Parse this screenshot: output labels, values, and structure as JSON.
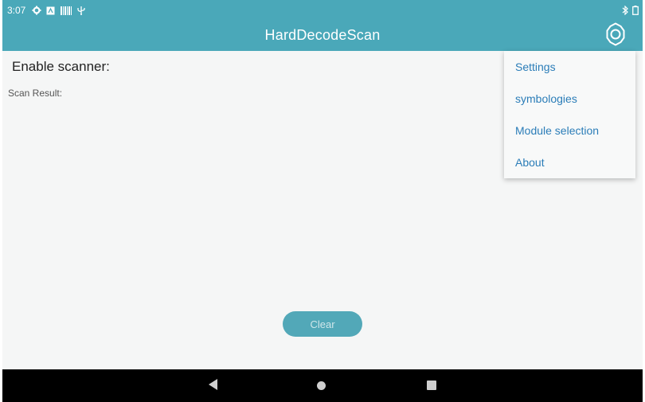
{
  "status_bar": {
    "time": "3:07",
    "icons": [
      "settings-gear-icon",
      "app-box-icon",
      "barcode-icon",
      "usb-icon",
      "bluetooth-icon",
      "battery-icon"
    ]
  },
  "app_bar": {
    "title": "HardDecodeScan",
    "settings_icon": "gear-icon"
  },
  "main": {
    "enable_scanner_label": "Enable scanner:",
    "scan_result_label": "Scan Result:",
    "clear_button": "Clear"
  },
  "menu": {
    "items": [
      {
        "label": "Settings"
      },
      {
        "label": "symbologies"
      },
      {
        "label": "Module selection"
      },
      {
        "label": "About"
      }
    ]
  },
  "nav_bar": {
    "icons": [
      "back-icon",
      "home-icon",
      "recents-icon"
    ]
  },
  "colors": {
    "app_bar": "#4aa8b9",
    "menu_text": "#2b7db8",
    "button": "#52a8b8",
    "nav_bar": "#000000"
  }
}
